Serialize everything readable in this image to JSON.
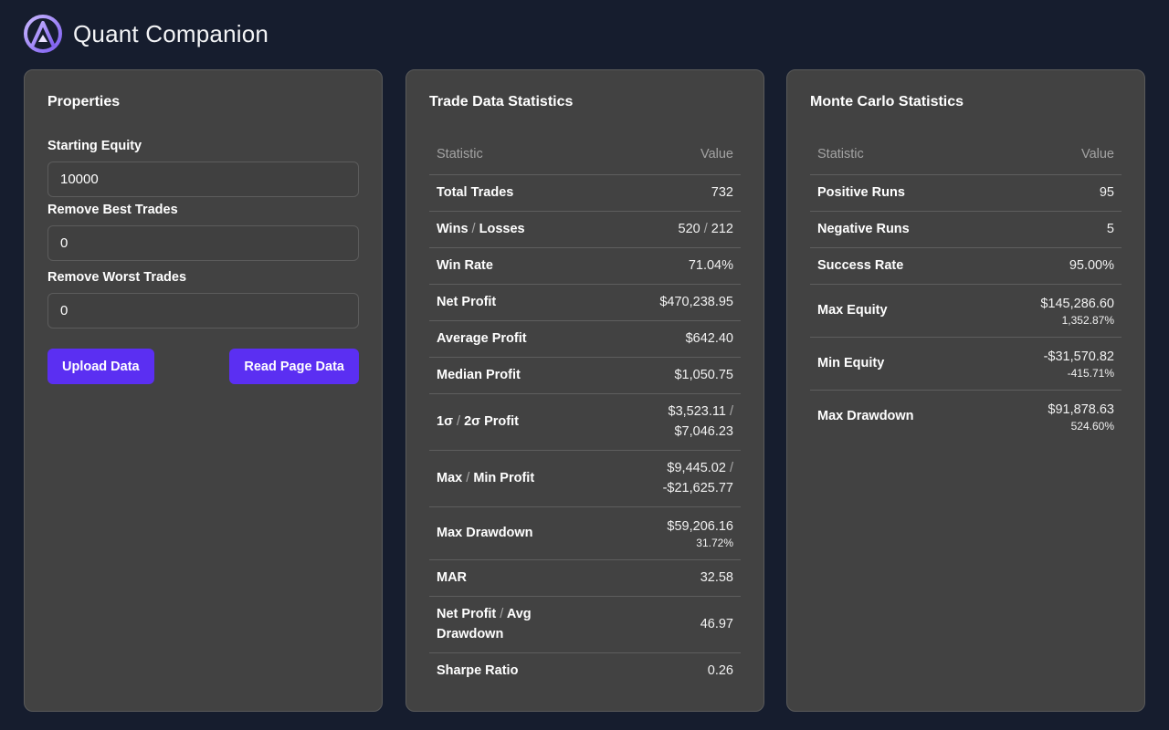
{
  "app": {
    "title": "Quant Companion"
  },
  "properties": {
    "title": "Properties",
    "starting_equity": {
      "label": "Starting Equity",
      "value": "10000"
    },
    "remove_best": {
      "label": "Remove Best Trades",
      "value": "0"
    },
    "remove_worst": {
      "label": "Remove Worst Trades",
      "value": "0"
    },
    "upload_label": "Upload Data",
    "read_label": "Read Page Data"
  },
  "trade_stats": {
    "title": "Trade Data Statistics",
    "col_stat": "Statistic",
    "col_value": "Value",
    "total_trades": {
      "label": "Total Trades",
      "value": "732"
    },
    "wins_losses": {
      "label_a": "Wins",
      "label_b": "Losses",
      "wins": "520",
      "losses": "212"
    },
    "win_rate": {
      "label": "Win Rate",
      "value": "71.04%"
    },
    "net_profit": {
      "label": "Net Profit",
      "value": "$470,238.95"
    },
    "avg_profit": {
      "label": "Average Profit",
      "value": "$642.40"
    },
    "median_profit": {
      "label": "Median Profit",
      "value": "$1,050.75"
    },
    "sigma_profit": {
      "label_a": "1σ",
      "label_b": "2σ Profit",
      "value_a": "$3,523.11",
      "value_b": "$7,046.23"
    },
    "max_min_profit": {
      "label_a": "Max",
      "label_b": "Min Profit",
      "value_a": "$9,445.02",
      "value_b": "-$21,625.77"
    },
    "max_drawdown": {
      "label": "Max Drawdown",
      "value": "$59,206.16",
      "pct": "31.72%"
    },
    "mar": {
      "label": "MAR",
      "value": "32.58"
    },
    "np_avg_dd": {
      "label_a": "Net Profit",
      "label_b": "Avg Drawdown",
      "value": "46.97"
    },
    "sharpe": {
      "label": "Sharpe Ratio",
      "value": "0.26"
    }
  },
  "mc_stats": {
    "title": "Monte Carlo Statistics",
    "col_stat": "Statistic",
    "col_value": "Value",
    "positive_runs": {
      "label": "Positive Runs",
      "value": "95"
    },
    "negative_runs": {
      "label": "Negative Runs",
      "value": "5"
    },
    "success_rate": {
      "label": "Success Rate",
      "value": "95.00%"
    },
    "max_equity": {
      "label": "Max Equity",
      "value": "$145,286.60",
      "pct": "1,352.87%"
    },
    "min_equity": {
      "label": "Min Equity",
      "value": "-$31,570.82",
      "pct": "-415.71%"
    },
    "max_drawdown": {
      "label": "Max Drawdown",
      "value": "$91,878.63",
      "pct": "524.60%"
    }
  },
  "colors": {
    "background": "#161d2e",
    "card": "#424242",
    "accent_button": "#5b2ff2",
    "logo_ring": "#9b7ff5"
  },
  "icons": {
    "logo": "quant-companion-logo"
  }
}
